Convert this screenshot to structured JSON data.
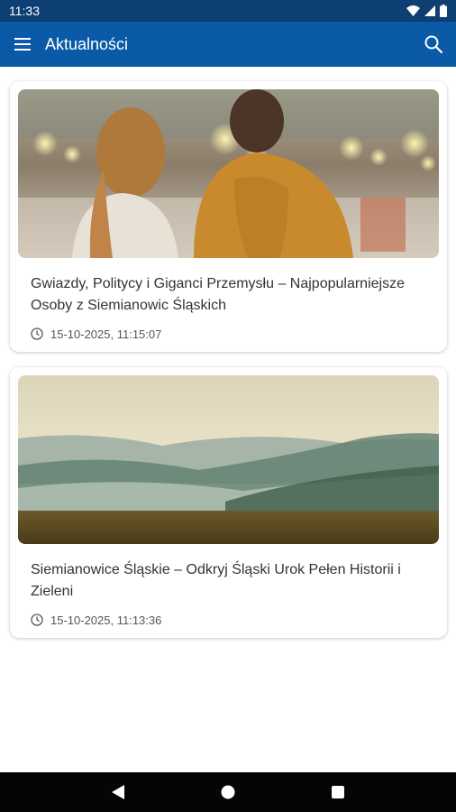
{
  "status_bar": {
    "time": "11:33",
    "icons": [
      "wifi-icon",
      "signal-icon",
      "battery-icon"
    ]
  },
  "app_bar": {
    "title": "Aktualności",
    "menu_icon": "menu-icon",
    "search_icon": "search-icon",
    "color": "#0b5aa8"
  },
  "articles": [
    {
      "title": "Gwiazdy, Politycy i Giganci Przemysłu – Najpopularniejsze Osoby z Siemianowic Śląskich",
      "date": "15-10-2025, 11:15:07",
      "image": "couple-at-night-market-photo"
    },
    {
      "title": "Siemianowice Śląskie – Odkryj Śląski Urok Pełen Historii i Zieleni",
      "date": "15-10-2025, 11:13:36",
      "image": "misty-hills-landscape-photo"
    }
  ],
  "nav_bar": {
    "icons": [
      "back-icon",
      "home-icon",
      "recents-icon"
    ]
  }
}
